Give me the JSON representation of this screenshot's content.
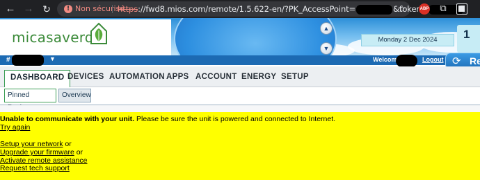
{
  "browser": {
    "security_label": "Non sécurisé",
    "url_scheme": "https",
    "url_main": "://fwd8.mios.com/remote/1.5.622-en/?PK_AccessPoint=",
    "url_mid": "&token=",
    "extension_badge": "ABP"
  },
  "header": {
    "logo_text": "micasaverde",
    "date": "Monday 2 Dec 2024",
    "date_tab_text": "1"
  },
  "bar": {
    "unit_hash": "#",
    "welcome": "Welcome",
    "logout": "Logout",
    "refresh_label": "Re"
  },
  "nav": {
    "tabs": [
      "DASHBOARD",
      "DEVICES",
      "AUTOMATION",
      "APPS",
      "ACCOUNT",
      "ENERGY",
      "SETUP"
    ],
    "subtabs": [
      "Pinned Devices",
      "Overview"
    ]
  },
  "alert": {
    "title": "Unable to communicate with your unit.",
    "message": " Please be sure the unit is powered and connected to Internet.",
    "try_again": "Try again",
    "setup_network": "Setup your network",
    "setup_network_suffix": " or",
    "upgrade_firmware": "Upgrade your firmware",
    "upgrade_firmware_suffix": " or",
    "remote_assistance": "Activate remote assistance",
    "tech_support": "Request tech support"
  },
  "colors": {
    "alert_bg": "#ffff00",
    "bar_blue": "#1c6ab3",
    "logo_green": "#3c8b3a"
  }
}
